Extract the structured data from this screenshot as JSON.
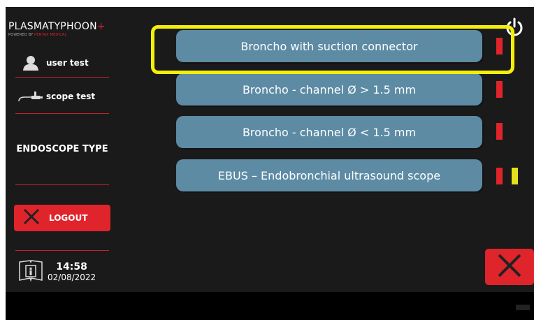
{
  "header": {
    "logo_main": "PLASMATYPHOON",
    "logo_plus": "+",
    "logo_sub_prefix": "POWERED BY",
    "logo_sub_brand": "PENTAX MEDICAL"
  },
  "sidebar": {
    "user_label": "user test",
    "scope_label": "scope test",
    "section_title": "ENDOSCOPE TYPE",
    "logout_label": "LOGOUT",
    "time": "14:58",
    "date": "02/08/2022"
  },
  "options": [
    {
      "label": "Broncho with suction connector",
      "indicators": [
        "red"
      ],
      "selected": true
    },
    {
      "label": "Broncho - channel Ø > 1.5 mm",
      "indicators": [
        "red"
      ]
    },
    {
      "label": "Broncho - channel Ø < 1.5 mm",
      "indicators": [
        "red"
      ]
    },
    {
      "label": "EBUS – Endobronchial ultrasound scope",
      "indicators": [
        "red",
        "yellow"
      ]
    }
  ],
  "colors": {
    "accent_red": "#e0242b",
    "option_blue": "#5d8ba4",
    "highlight_yellow": "#f4ee0a",
    "indicator_yellow": "#e6e01a",
    "background": "#1a1a1a"
  },
  "icons": [
    "user-icon",
    "scope-icon",
    "close-icon",
    "info-book-icon",
    "power-icon"
  ]
}
